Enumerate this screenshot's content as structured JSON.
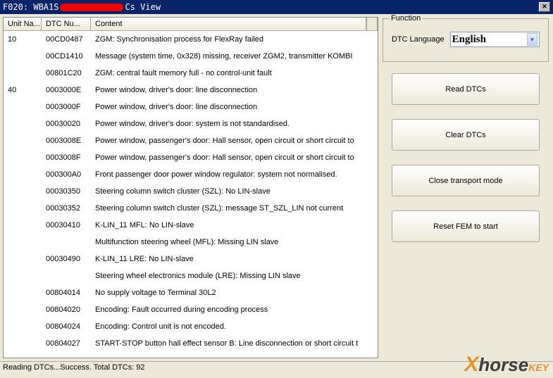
{
  "title_prefix": "F020: WBA1S",
  "title_suffix": "Cs View",
  "columns": {
    "unit": "Unit Na...",
    "dtc": "DTC Nu...",
    "content": "Content"
  },
  "rows": [
    {
      "unit": "10",
      "dtc": "00CD0487",
      "content": "ZGM: Synchronisation process for FlexRay failed"
    },
    {
      "unit": "",
      "dtc": "00CD1410",
      "content": "Message (system time, 0x328) missing, receiver ZGM2, transmitter KOMBI"
    },
    {
      "unit": "",
      "dtc": "00801C20",
      "content": "ZGM: central fault memory full - no control-unit fault"
    },
    {
      "unit": "40",
      "dtc": "0003000E",
      "content": "Power window, driver's door: line disconnection"
    },
    {
      "unit": "",
      "dtc": "0003000F",
      "content": "Power window, driver's door: line disconnection"
    },
    {
      "unit": "",
      "dtc": "00030020",
      "content": "Power window, driver's door: system is not standardised."
    },
    {
      "unit": "",
      "dtc": "0003008E",
      "content": "Power window, passenger's door: Hall sensor, open circuit or short circuit to"
    },
    {
      "unit": "",
      "dtc": "0003008F",
      "content": "Power window, passenger's door: Hall sensor, open circuit or short circuit to"
    },
    {
      "unit": "",
      "dtc": "000300A0",
      "content": "Front passenger door power window regulator: system not normalised."
    },
    {
      "unit": "",
      "dtc": "00030350",
      "content": "Steering column switch cluster (SZL): No LIN-slave"
    },
    {
      "unit": "",
      "dtc": "00030352",
      "content": "Steering column switch cluster (SZL): message ST_SZL_LIN not current"
    },
    {
      "unit": "",
      "dtc": "00030410",
      "content": "K-LIN_11 MFL: No LIN-slave"
    },
    {
      "unit": "",
      "dtc": "",
      "content": "Multifunction steering wheel (MFL): Missing LIN slave"
    },
    {
      "unit": "",
      "dtc": "00030490",
      "content": "K-LIN_11 LRE: No LIN-slave"
    },
    {
      "unit": "",
      "dtc": "",
      "content": "Steering wheel electronics module (LRE): Missing LIN slave"
    },
    {
      "unit": "",
      "dtc": "00804014",
      "content": "No supply voltage to Terminal 30L2"
    },
    {
      "unit": "",
      "dtc": "00804020",
      "content": "Encoding: Fault occurred during encoding process"
    },
    {
      "unit": "",
      "dtc": "00804024",
      "content": "Encoding: Control unit is not encoded."
    },
    {
      "unit": "",
      "dtc": "00804027",
      "content": "START-STOP button hall effect sensor B: Line disconnection or short circuit t"
    }
  ],
  "function": {
    "legend": "Function",
    "lang_label": "DTC Language",
    "lang_value": "English",
    "buttons": {
      "read": "Read DTCs",
      "clear": "Clear DTCs",
      "transport": "Close transport mode",
      "reset": "Reset FEM to start"
    }
  },
  "status": "Reading DTCs...Success.  Total DTCs: 92",
  "watermark": {
    "x": "X",
    "horse": "horse",
    "key": "KEY"
  }
}
